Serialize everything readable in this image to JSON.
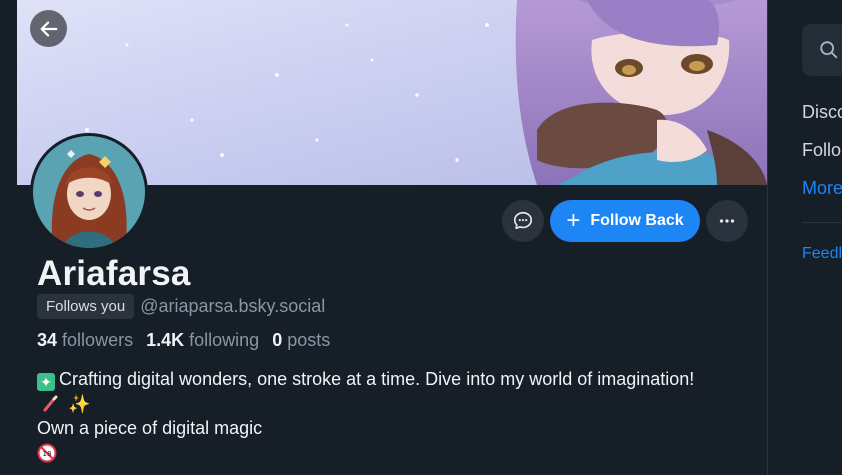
{
  "colors": {
    "background": "#161e27",
    "accent": "#1e85f5",
    "text_primary": "#f1f3f5",
    "text_secondary": "#8a96a5",
    "button_bg": "#29323d"
  },
  "header": {
    "back_icon": "arrow-left-icon"
  },
  "profile": {
    "display_name": "Ariafarsa",
    "follows_you_label": "Follows you",
    "handle": "@ariaparsa.bsky.social",
    "stats": {
      "followers_count": "34",
      "followers_label": "followers",
      "following_count": "1.4K",
      "following_label": "following",
      "posts_count": "0",
      "posts_label": "posts"
    },
    "bio": {
      "line1": "Crafting digital wonders, one stroke at a time. Dive into my world of imagination!",
      "line1_emoji_start": "sparkle-emoji",
      "line1_emoji_end": [
        "paintbrush-emoji",
        "sparkles-emoji"
      ],
      "line2": "Own a piece of digital magic",
      "line3_emoji": "no-under-18-emoji"
    }
  },
  "actions": {
    "message_icon": "chat-bubble-icon",
    "follow_label": "Follow Back",
    "follow_icon": "plus-icon",
    "more_icon": "ellipsis-icon"
  },
  "right_sidebar": {
    "search_icon": "search-icon",
    "links": [
      "Disco",
      "Follo",
      "More"
    ],
    "feed_link": "Feedl"
  }
}
